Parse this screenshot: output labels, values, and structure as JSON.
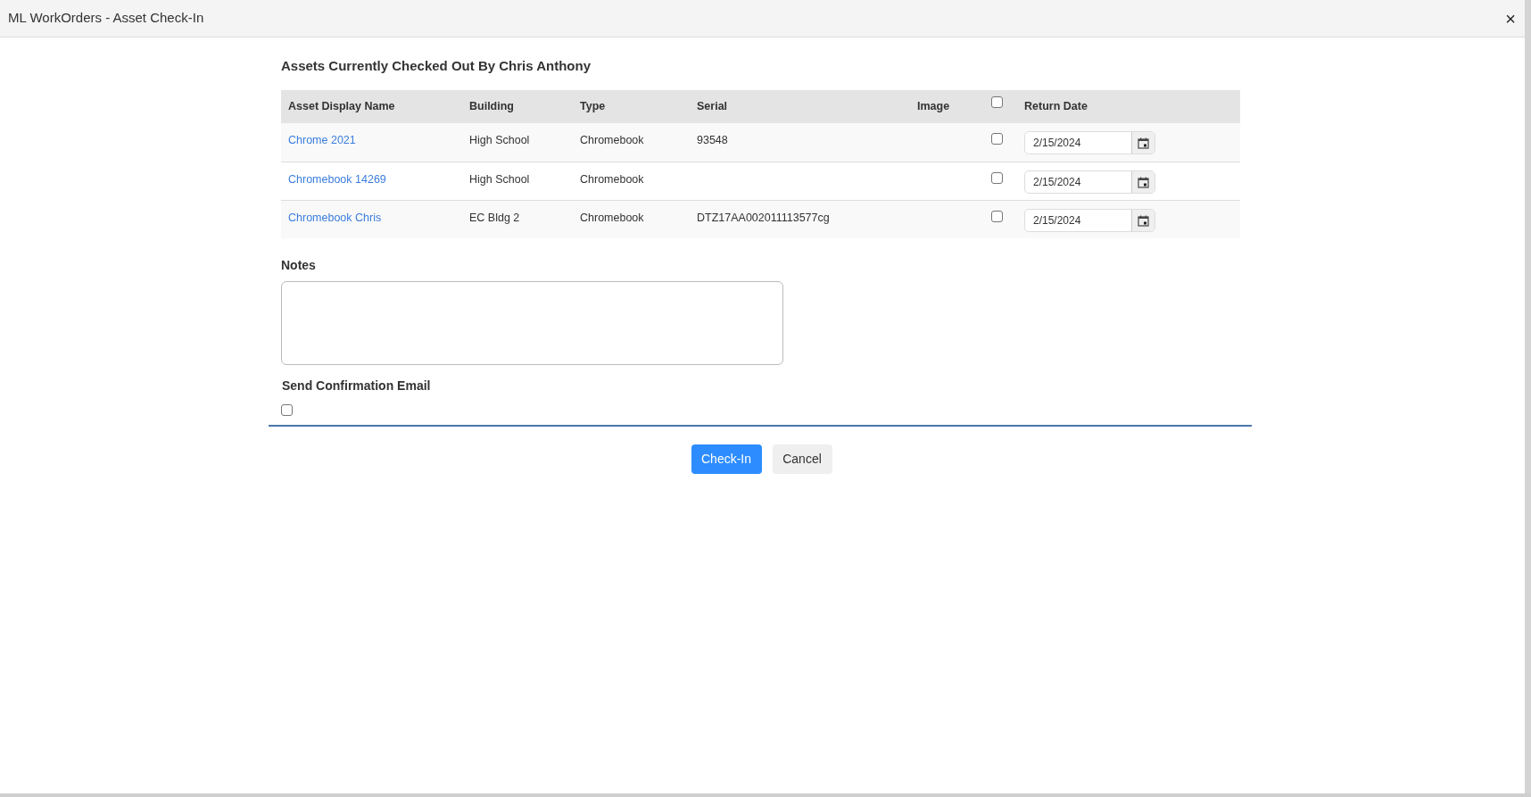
{
  "window": {
    "title": "ML WorkOrders - Asset Check-In",
    "close": "×"
  },
  "heading": "Assets Currently Checked Out By Chris Anthony",
  "table": {
    "columns": [
      "Asset Display Name",
      "Building",
      "Type",
      "Serial",
      "Image",
      "Return Date"
    ],
    "select_all_checked": false,
    "rows": [
      {
        "name": "Chrome 2021",
        "building": "High School",
        "type": "Chromebook",
        "serial": "93548",
        "checked": false,
        "return_date": "2/15/2024"
      },
      {
        "name": "Chromebook 14269",
        "building": "High School",
        "type": "Chromebook",
        "checked": false,
        "return_date": "2/15/2024"
      },
      {
        "name": "Chromebook Chris",
        "building": "EC Bldg 2",
        "type": "Chromebook",
        "serial": "DTZ17AA002011113577cg",
        "checked": false,
        "return_date": "2/15/2024"
      }
    ]
  },
  "notes": {
    "label": "Notes"
  },
  "confirmation": {
    "label": "Send Confirmation Email",
    "checked": false
  },
  "buttons": [
    "Check-In",
    "Cancel"
  ]
}
